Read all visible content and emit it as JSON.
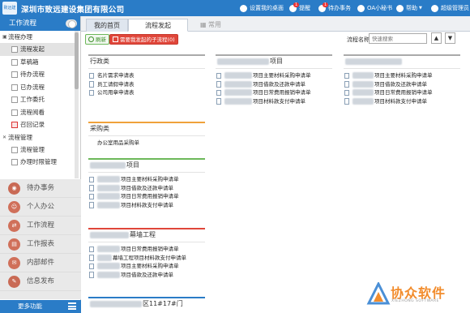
{
  "topbar": {
    "logo_text": "致远建设",
    "company": "深圳市致远建设集团有限公司",
    "actions": [
      {
        "label": "设置我的桌面"
      },
      {
        "label": "提醒",
        "badge": "1"
      },
      {
        "label": "待办事务",
        "badge": "1"
      },
      {
        "label": "OA小秘书"
      },
      {
        "label": "帮助"
      },
      {
        "label": "超级管理员"
      }
    ]
  },
  "sidebar": {
    "title": "工作流程",
    "tree": [
      {
        "type": "group",
        "label": "流程办理"
      },
      {
        "type": "item",
        "label": "流程发起",
        "active": true
      },
      {
        "type": "item",
        "label": "草稿箱"
      },
      {
        "type": "item",
        "label": "待办流程"
      },
      {
        "type": "item",
        "label": "已办流程"
      },
      {
        "type": "item",
        "label": "工作委托"
      },
      {
        "type": "item",
        "label": "流程阅看"
      },
      {
        "type": "item",
        "label": "召回记录",
        "red": true
      },
      {
        "type": "group",
        "label": "流程管理"
      },
      {
        "type": "item",
        "label": "流程管理"
      },
      {
        "type": "item",
        "label": "办理时限管理"
      }
    ],
    "modules": [
      {
        "label": "待办事务",
        "color": "#c96a55"
      },
      {
        "label": "个人办公",
        "color": "#d0705a"
      },
      {
        "label": "工作流程",
        "color": "#d0705a"
      },
      {
        "label": "工作报表",
        "color": "#d0705a"
      },
      {
        "label": "内部邮件",
        "color": "#d0705a"
      },
      {
        "label": "信息发布",
        "color": "#c96a55"
      }
    ],
    "more_label": "更多功能"
  },
  "tabs": [
    {
      "label": "我的首页"
    },
    {
      "label": "流程发起"
    },
    {
      "label": "常用"
    }
  ],
  "toolbar": {
    "refresh_label": "刷新",
    "todo_label": "需要我发起的子流程(0)",
    "search_label": "流程名称:",
    "search_placeholder": "快速搜索",
    "up_icon": "▲",
    "down_icon": "▼"
  },
  "cards": {
    "admin": {
      "title": "行政类",
      "items": [
        "名片需求申请表",
        "员工请假申请表",
        "公司用章申请表"
      ]
    },
    "purchase": {
      "title": "采购类",
      "items": [
        "办公室用品采购单"
      ]
    },
    "proj1": {
      "title": "项目",
      "items": [
        "项目主要材料采购申请单",
        "项目借款及还款申请单",
        "项目日常费用报销申请单",
        "项目材料款支付申请单"
      ]
    },
    "proj2": {
      "title": "幕墙工程",
      "items": [
        "项目日常费用报销申请单",
        "幕墙工程项目材料款支付申请单",
        "项目主要材料采购申请单",
        "项目借款及还款申请单"
      ]
    },
    "proj3": {
      "title": "区11#17#门"
    },
    "col2": {
      "title": "项目",
      "items": [
        "项目主要材料采购申请单",
        "项目借款及还款申请单",
        "项目日常费用报销申请单",
        "项目材料款支付申请单"
      ]
    },
    "col3": {
      "items": [
        "项目主要材料采购申请单",
        "项目借款及还款申请单",
        "项目日常费用报销申请单",
        "项目材料款支付申请单"
      ]
    }
  },
  "watermark": {
    "title": "协众软件",
    "subtitle": "XIEZHONG SOFTWARE"
  }
}
